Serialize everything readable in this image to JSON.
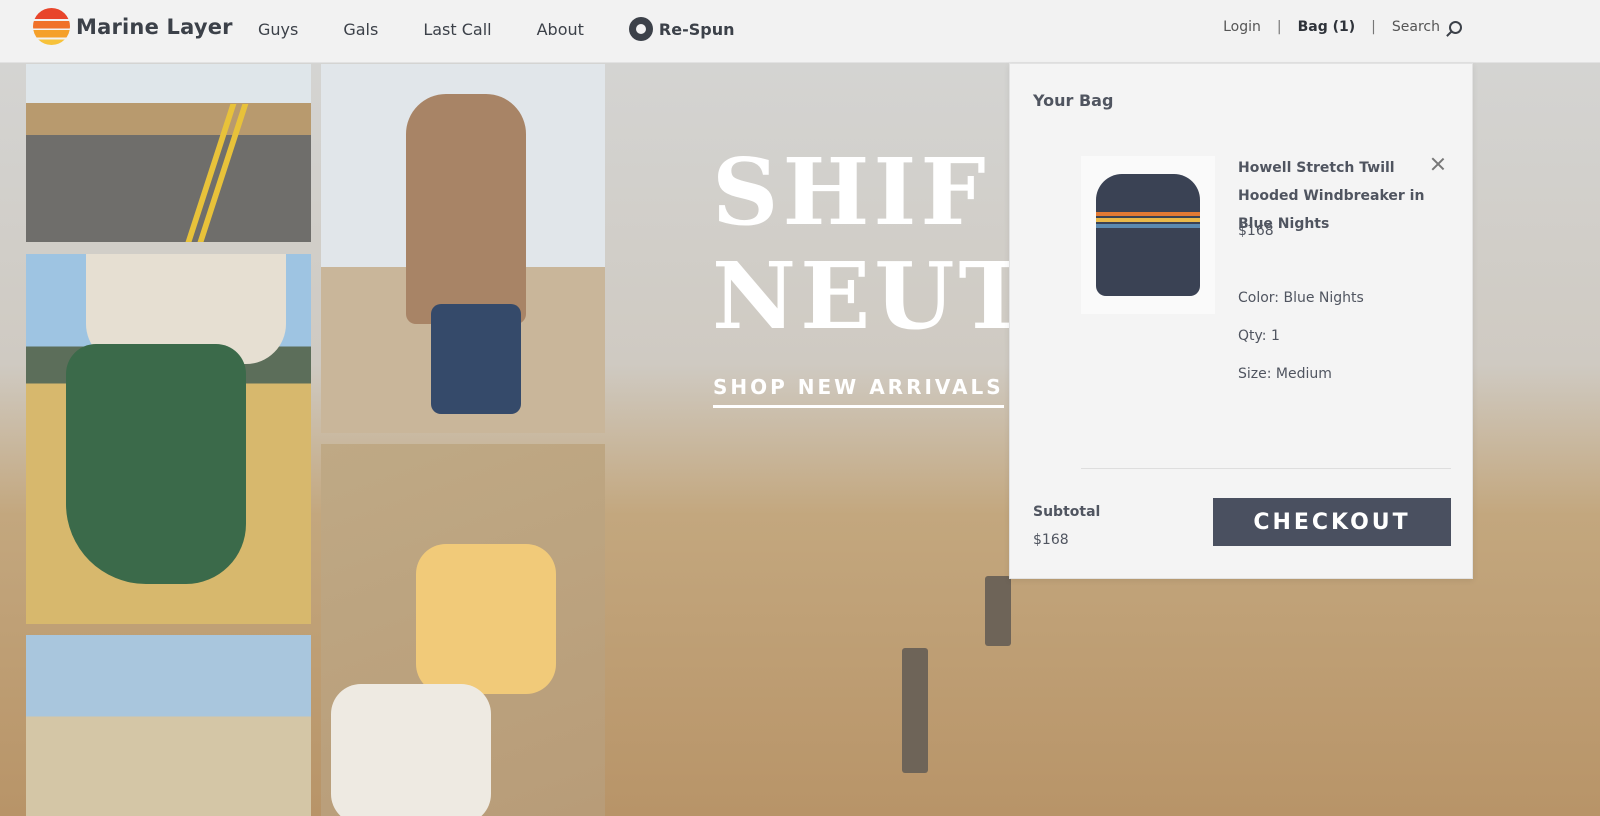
{
  "brand": {
    "name": "Marine Layer"
  },
  "nav": {
    "items": [
      {
        "label": "Guys"
      },
      {
        "label": "Gals"
      },
      {
        "label": "Last Call"
      },
      {
        "label": "About"
      }
    ],
    "respun_label": "Re-Spun"
  },
  "utility": {
    "login": "Login",
    "separator": "|",
    "bag": "Bag (1)",
    "search": "Search"
  },
  "hero": {
    "title_line1": "SHIF",
    "title_line2": "NEUT",
    "cta": "SHOP NEW ARRIVALS"
  },
  "bag_panel": {
    "title": "Your Bag",
    "item": {
      "name": "Howell Stretch Twill Hooded Windbreaker in Blue Nights",
      "price": "$168",
      "color": "Color: Blue Nights",
      "qty": "Qty: 1",
      "size": "Size: Medium"
    },
    "subtotal_label": "Subtotal",
    "subtotal_value": "$168",
    "checkout_label": "CHECKOUT"
  },
  "colors": {
    "header_bg": "#f2f2f2",
    "text_dark": "#3c4149",
    "checkout_bg": "#4a5060",
    "panel_bg": "#f4f4f4"
  },
  "icons": [
    "marine-layer-logo-icon",
    "respun-icon",
    "search-icon",
    "close-icon"
  ]
}
